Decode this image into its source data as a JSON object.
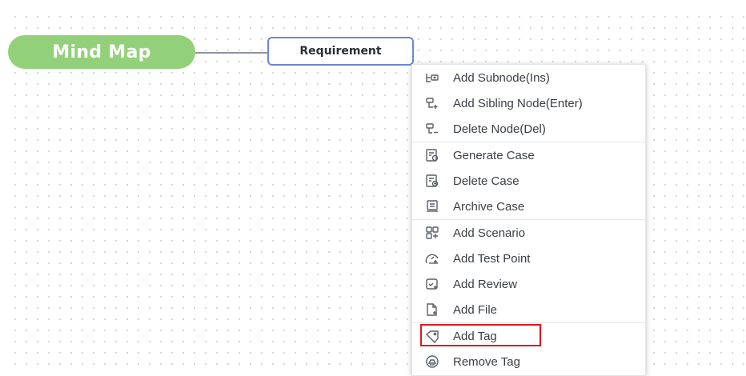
{
  "mindmap": {
    "root_label": "Mind Map",
    "child_label": "Requirement"
  },
  "context_menu": {
    "groups": [
      {
        "items": [
          {
            "label": "Add Subnode(Ins)",
            "icon": "add-subnode-icon"
          },
          {
            "label": "Add Sibling Node(Enter)",
            "icon": "add-sibling-icon"
          },
          {
            "label": "Delete Node(Del)",
            "icon": "delete-node-icon"
          }
        ]
      },
      {
        "items": [
          {
            "label": "Generate Case",
            "icon": "generate-case-icon"
          },
          {
            "label": "Delete Case",
            "icon": "delete-case-icon"
          },
          {
            "label": "Archive Case",
            "icon": "archive-case-icon"
          }
        ]
      },
      {
        "items": [
          {
            "label": "Add Scenario",
            "icon": "add-scenario-icon"
          },
          {
            "label": "Add Test Point",
            "icon": "add-test-point-icon"
          },
          {
            "label": "Add Review",
            "icon": "add-review-icon"
          },
          {
            "label": "Add File",
            "icon": "add-file-icon"
          }
        ]
      },
      {
        "items": [
          {
            "label": "Add Tag",
            "icon": "tag-icon",
            "highlighted": true
          },
          {
            "label": "Remove Tag",
            "icon": "remove-tag-icon"
          }
        ]
      }
    ]
  },
  "colors": {
    "root_fill": "#93d07a",
    "child_border": "#6c86d3",
    "highlight": "#e0171d"
  }
}
